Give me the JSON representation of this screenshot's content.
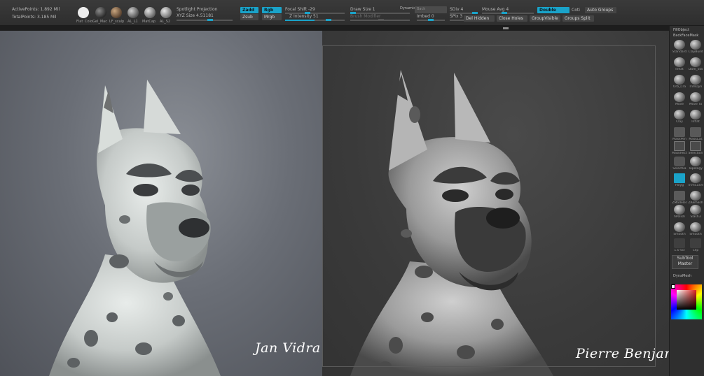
{
  "stats": {
    "active_points": "ActivePoints: 1.892 Mil",
    "total_points": "TotalPoints: 3.185 Mil"
  },
  "materials": [
    {
      "label": "Flat",
      "color": "#ededed"
    },
    {
      "label": "Colo",
      "color": "#ededed"
    },
    {
      "label": "Gel_Mac",
      "color": "#4a4a4a"
    },
    {
      "label": "LF_scalp",
      "color": "#7a6247"
    },
    {
      "label": "AL_L1",
      "color": "#8a8a8a"
    },
    {
      "label": "MatCap",
      "color": "#9b9b9b"
    },
    {
      "label": "AL_S2",
      "color": "#a6a6a6"
    }
  ],
  "projection": {
    "spotlight": "Spotlight Projection",
    "xyz_size": "XYZ Size 4.51181"
  },
  "toggles": {
    "zadd": "Zadd",
    "zsub": "Zsub",
    "rgb": "Rgb",
    "mrgb": "Mrgb"
  },
  "brush": {
    "focal_shift": "Focal Shift -29",
    "z_intensity": "Z Intensity 51",
    "draw_size": "Draw Size 1",
    "dynamic": "Dynamic",
    "backface": "Back",
    "brush_modifier": "Brush Modifier",
    "imbed": "Imbed 0",
    "sdiv": "SDiv 4",
    "spix": "SPix 3",
    "mouse_avg": "Mouse Avg 4",
    "double": "Double",
    "coti": "Coti"
  },
  "actions": {
    "auto_groups": "Auto Groups",
    "del_hidden": "Del Hidden",
    "close_holes": "Close Holes",
    "group_visible": "GroupVisible",
    "groups_split": "Groups Split"
  },
  "signatures": {
    "left": "Jan Vidra",
    "right": "Pierre Benjamin"
  },
  "palette": {
    "fill_object": "FillObject",
    "backface_mask": "BackFaceMask",
    "subtool_master_1": "SubTool",
    "subtool_master_2": "Master",
    "dynamesh": "DynaMesh",
    "tools": [
      "Standard",
      "ClayBuild",
      "Inflat",
      "Dam_Sta",
      "Orb_Cra",
      "TrimDyn",
      "Move",
      "Move To",
      "Clay",
      "Inflat",
      "MaskPen",
      "MaskLas",
      "MaskRect",
      "Selection",
      "SelectLa",
      "Topology",
      "Polyg",
      "TrimCurve",
      "ZModeler",
      "ZRemesh",
      "hPolish",
      "Slash3",
      "Smooth",
      "Smooth",
      "1.0 Scl",
      "Clip",
      "",
      ""
    ]
  }
}
